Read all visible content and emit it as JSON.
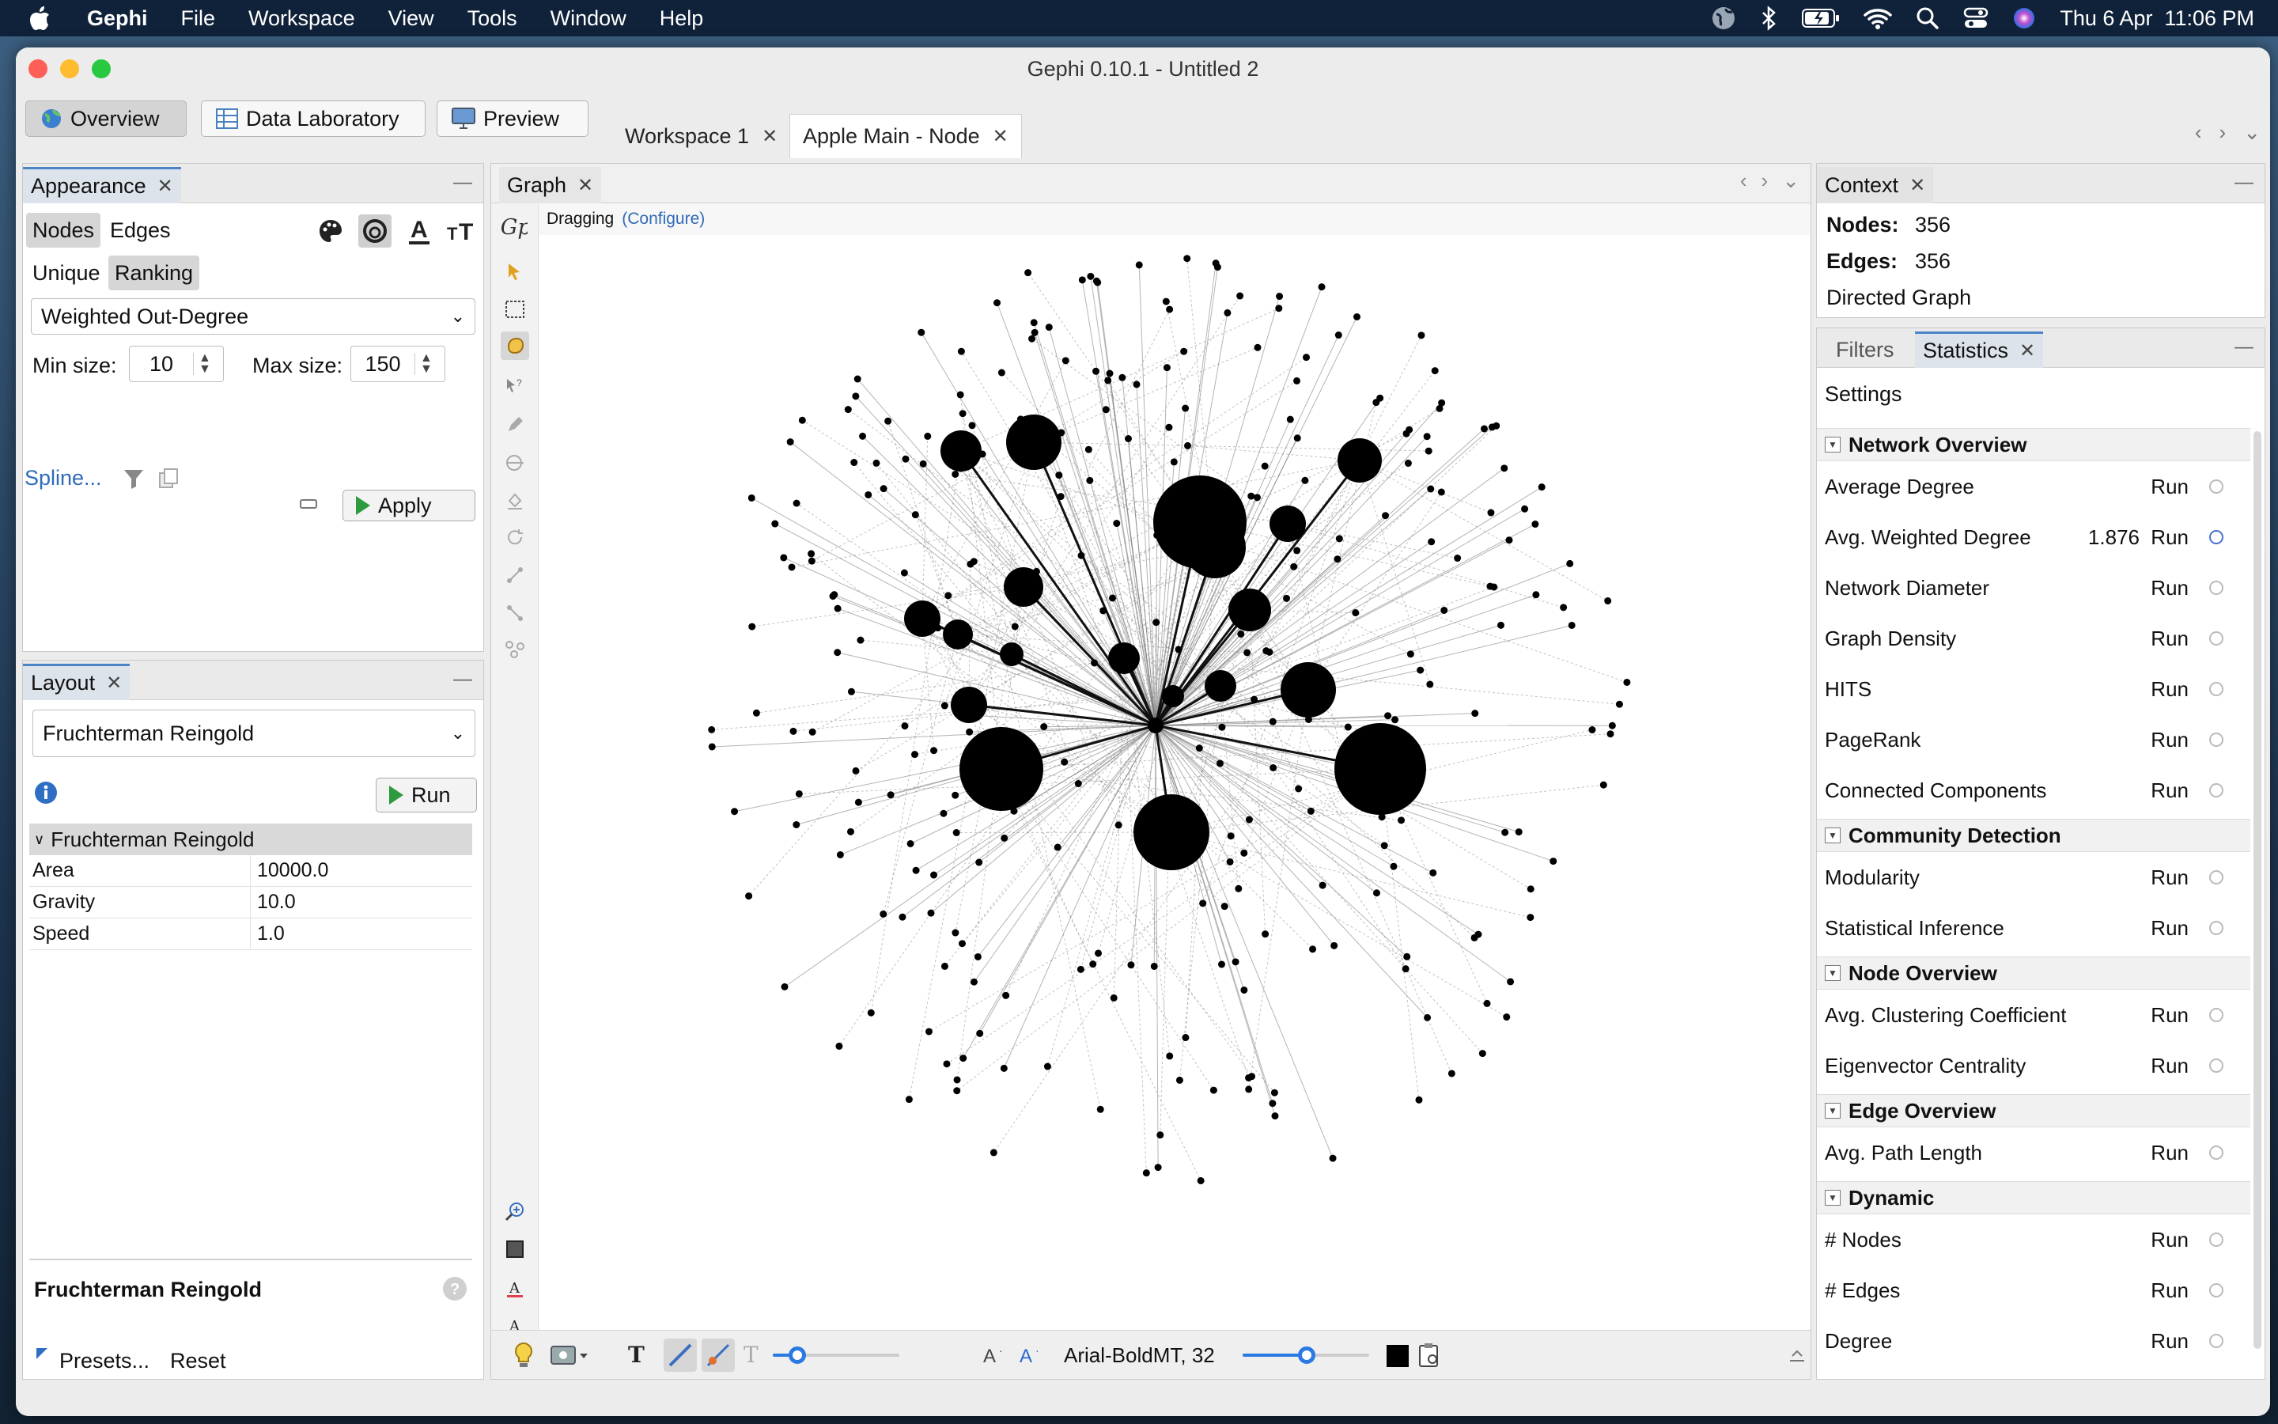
{
  "menubar": {
    "app": "Gephi",
    "items": [
      "File",
      "Workspace",
      "View",
      "Tools",
      "Window",
      "Help"
    ],
    "datetime": "Thu 6 Apr  11:06 PM"
  },
  "window": {
    "title": "Gephi 0.10.1 - Untitled 2",
    "modes": [
      "Overview",
      "Data Laboratory",
      "Preview"
    ],
    "doc_tabs": [
      "Workspace 1",
      "Apple Main - Node"
    ]
  },
  "appearance": {
    "title": "Appearance",
    "target_tabs": [
      "Nodes",
      "Edges"
    ],
    "mode_tabs": [
      "Unique",
      "Ranking"
    ],
    "attribute": "Weighted Out-Degree",
    "min_label": "Min size:",
    "min_value": "10",
    "max_label": "Max size:",
    "max_value": "150",
    "spline": "Spline...",
    "apply": "Apply"
  },
  "layout": {
    "title": "Layout",
    "algorithm": "Fruchterman Reingold",
    "run": "Run",
    "group": "Fruchterman Reingold",
    "props": [
      {
        "name": "Area",
        "value": "10000.0"
      },
      {
        "name": "Gravity",
        "value": "10.0"
      },
      {
        "name": "Speed",
        "value": "1.0"
      }
    ],
    "desc_title": "Fruchterman Reingold",
    "presets": "Presets...",
    "reset": "Reset"
  },
  "graph": {
    "title": "Graph",
    "mode": "Dragging",
    "configure": "(Configure)",
    "font_label": "Arial-BoldMT, 32"
  },
  "context": {
    "title": "Context",
    "nodes_label": "Nodes:",
    "nodes": "356",
    "edges_label": "Edges:",
    "edges": "356",
    "type": "Directed Graph"
  },
  "statistics": {
    "tabs": [
      "Filters",
      "Statistics"
    ],
    "settings": "Settings",
    "run_label": "Run",
    "sections": [
      {
        "title": "Network Overview",
        "rows": [
          {
            "name": "Average Degree",
            "value": ""
          },
          {
            "name": "Avg. Weighted Degree",
            "value": "1.876"
          },
          {
            "name": "Network Diameter",
            "value": ""
          },
          {
            "name": "Graph Density",
            "value": ""
          },
          {
            "name": "HITS",
            "value": ""
          },
          {
            "name": "PageRank",
            "value": ""
          },
          {
            "name": "Connected Components",
            "value": ""
          }
        ]
      },
      {
        "title": "Community Detection",
        "rows": [
          {
            "name": "Modularity",
            "value": ""
          },
          {
            "name": "Statistical Inference",
            "value": ""
          }
        ]
      },
      {
        "title": "Node Overview",
        "rows": [
          {
            "name": "Avg. Clustering Coefficient",
            "value": ""
          },
          {
            "name": "Eigenvector Centrality",
            "value": ""
          }
        ]
      },
      {
        "title": "Edge Overview",
        "rows": [
          {
            "name": "Avg. Path Length",
            "value": ""
          }
        ]
      },
      {
        "title": "Dynamic",
        "rows": [
          {
            "name": "# Nodes",
            "value": ""
          },
          {
            "name": "# Edges",
            "value": ""
          },
          {
            "name": "Degree",
            "value": ""
          }
        ]
      }
    ]
  }
}
